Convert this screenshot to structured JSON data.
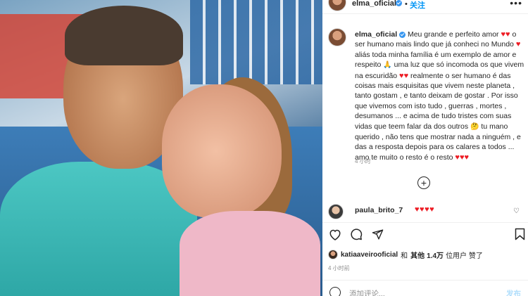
{
  "header": {
    "username": "elma_oficial",
    "separator": "•",
    "follow_label": "关注",
    "more_icon": "more-horizontal-icon"
  },
  "caption": {
    "username": "elma_oficial",
    "lines": [
      "Meu grande e perfeito amor",
      "o ser humano mais lindo que já conheci no Mundo",
      "aliás toda minha família é um exemplo de amor e respeito",
      "uma luz que só incomoda os que vivem na escuridão",
      "realmente o ser humano é das coisas mais esquisitas que vivem neste planeta , tanto gostam , e tanto deixam de gostar . Por isso que vivemos com isto tudo , guerras , mortes , desumanos ... e acima de tudo tristes com suas vidas que teem falar da dos outros",
      "tu mano querido , não tens que mostrar nada a ninguém , e das a resposta depois para os calares a todos ... amo te muito o resto é o resto"
    ],
    "time": "4 小时"
  },
  "comment": {
    "username": "paula_brito_7",
    "hearts": "♥♥♥♥"
  },
  "likes": {
    "user": "katiaaveirooficial",
    "text_and": "和",
    "text_others": "其他",
    "count": "1.4万",
    "text_suffix": "位用户 赞了"
  },
  "post_time": "4 小时前",
  "add_comment": {
    "placeholder": "添加评论...",
    "post_label": "发布"
  },
  "colors": {
    "accent": "#0095f6",
    "heart": "#ed1c24",
    "verified": "#3897f0",
    "muted": "#8e8e8e"
  }
}
